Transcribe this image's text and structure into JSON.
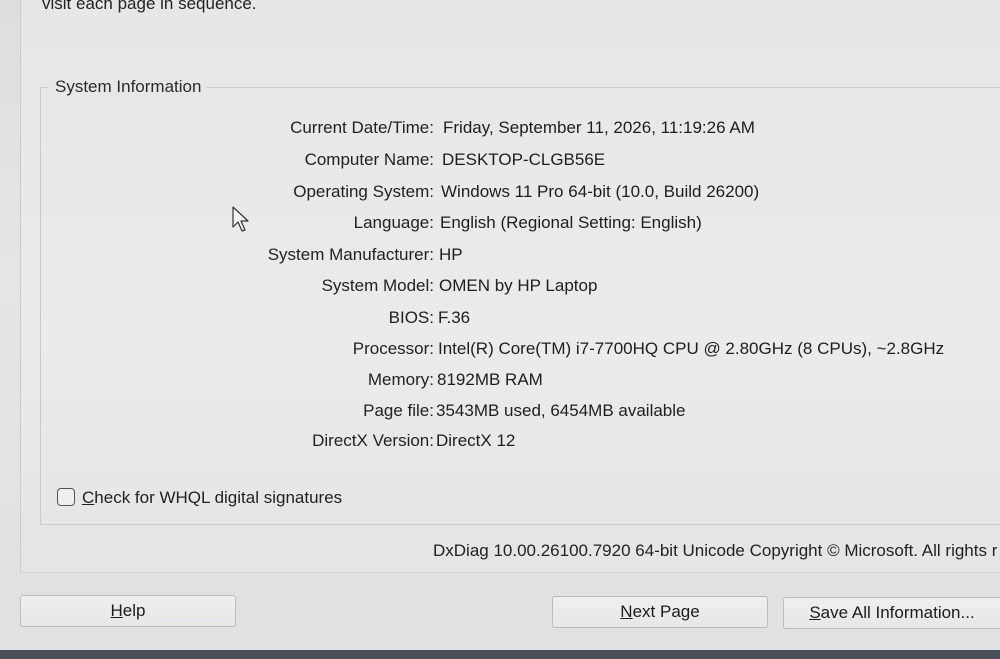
{
  "intro_text": "visit each page in sequence.",
  "group": {
    "title": "System Information",
    "rows": [
      {
        "label": "Current Date/Time:",
        "value": "Friday, September 11, 2026, 11:19:26 AM"
      },
      {
        "label": "Computer Name:",
        "value": "DESKTOP-CLGB56E"
      },
      {
        "label": "Operating System:",
        "value": "Windows 11 Pro 64-bit (10.0, Build 26200)"
      },
      {
        "label": "Language:",
        "value": "English (Regional Setting: English)"
      },
      {
        "label": "System Manufacturer:",
        "value": "HP"
      },
      {
        "label": "System Model:",
        "value": "OMEN by HP Laptop"
      },
      {
        "label": "BIOS:",
        "value": "F.36"
      },
      {
        "label": "Processor:",
        "value": "Intel(R) Core(TM) i7-7700HQ CPU @ 2.80GHz (8 CPUs), ~2.8GHz"
      },
      {
        "label": "Memory:",
        "value": "8192MB RAM"
      },
      {
        "label": "Page file:",
        "value": "3543MB used, 6454MB available"
      },
      {
        "label": "DirectX Version:",
        "value": "DirectX 12"
      }
    ]
  },
  "whql": {
    "label_rest": "heck for WHQL digital signatures",
    "label_accel": "C",
    "checked": false
  },
  "footer": {
    "version_text": "DxDiag 10.00.26100.7920 64-bit Unicode  Copyright © Microsoft. All rights r"
  },
  "buttons": {
    "help_accel": "H",
    "help_rest": "elp",
    "next_accel": "N",
    "next_rest": "ext Page",
    "save_accel": "S",
    "save_rest": "ave All Information..."
  }
}
